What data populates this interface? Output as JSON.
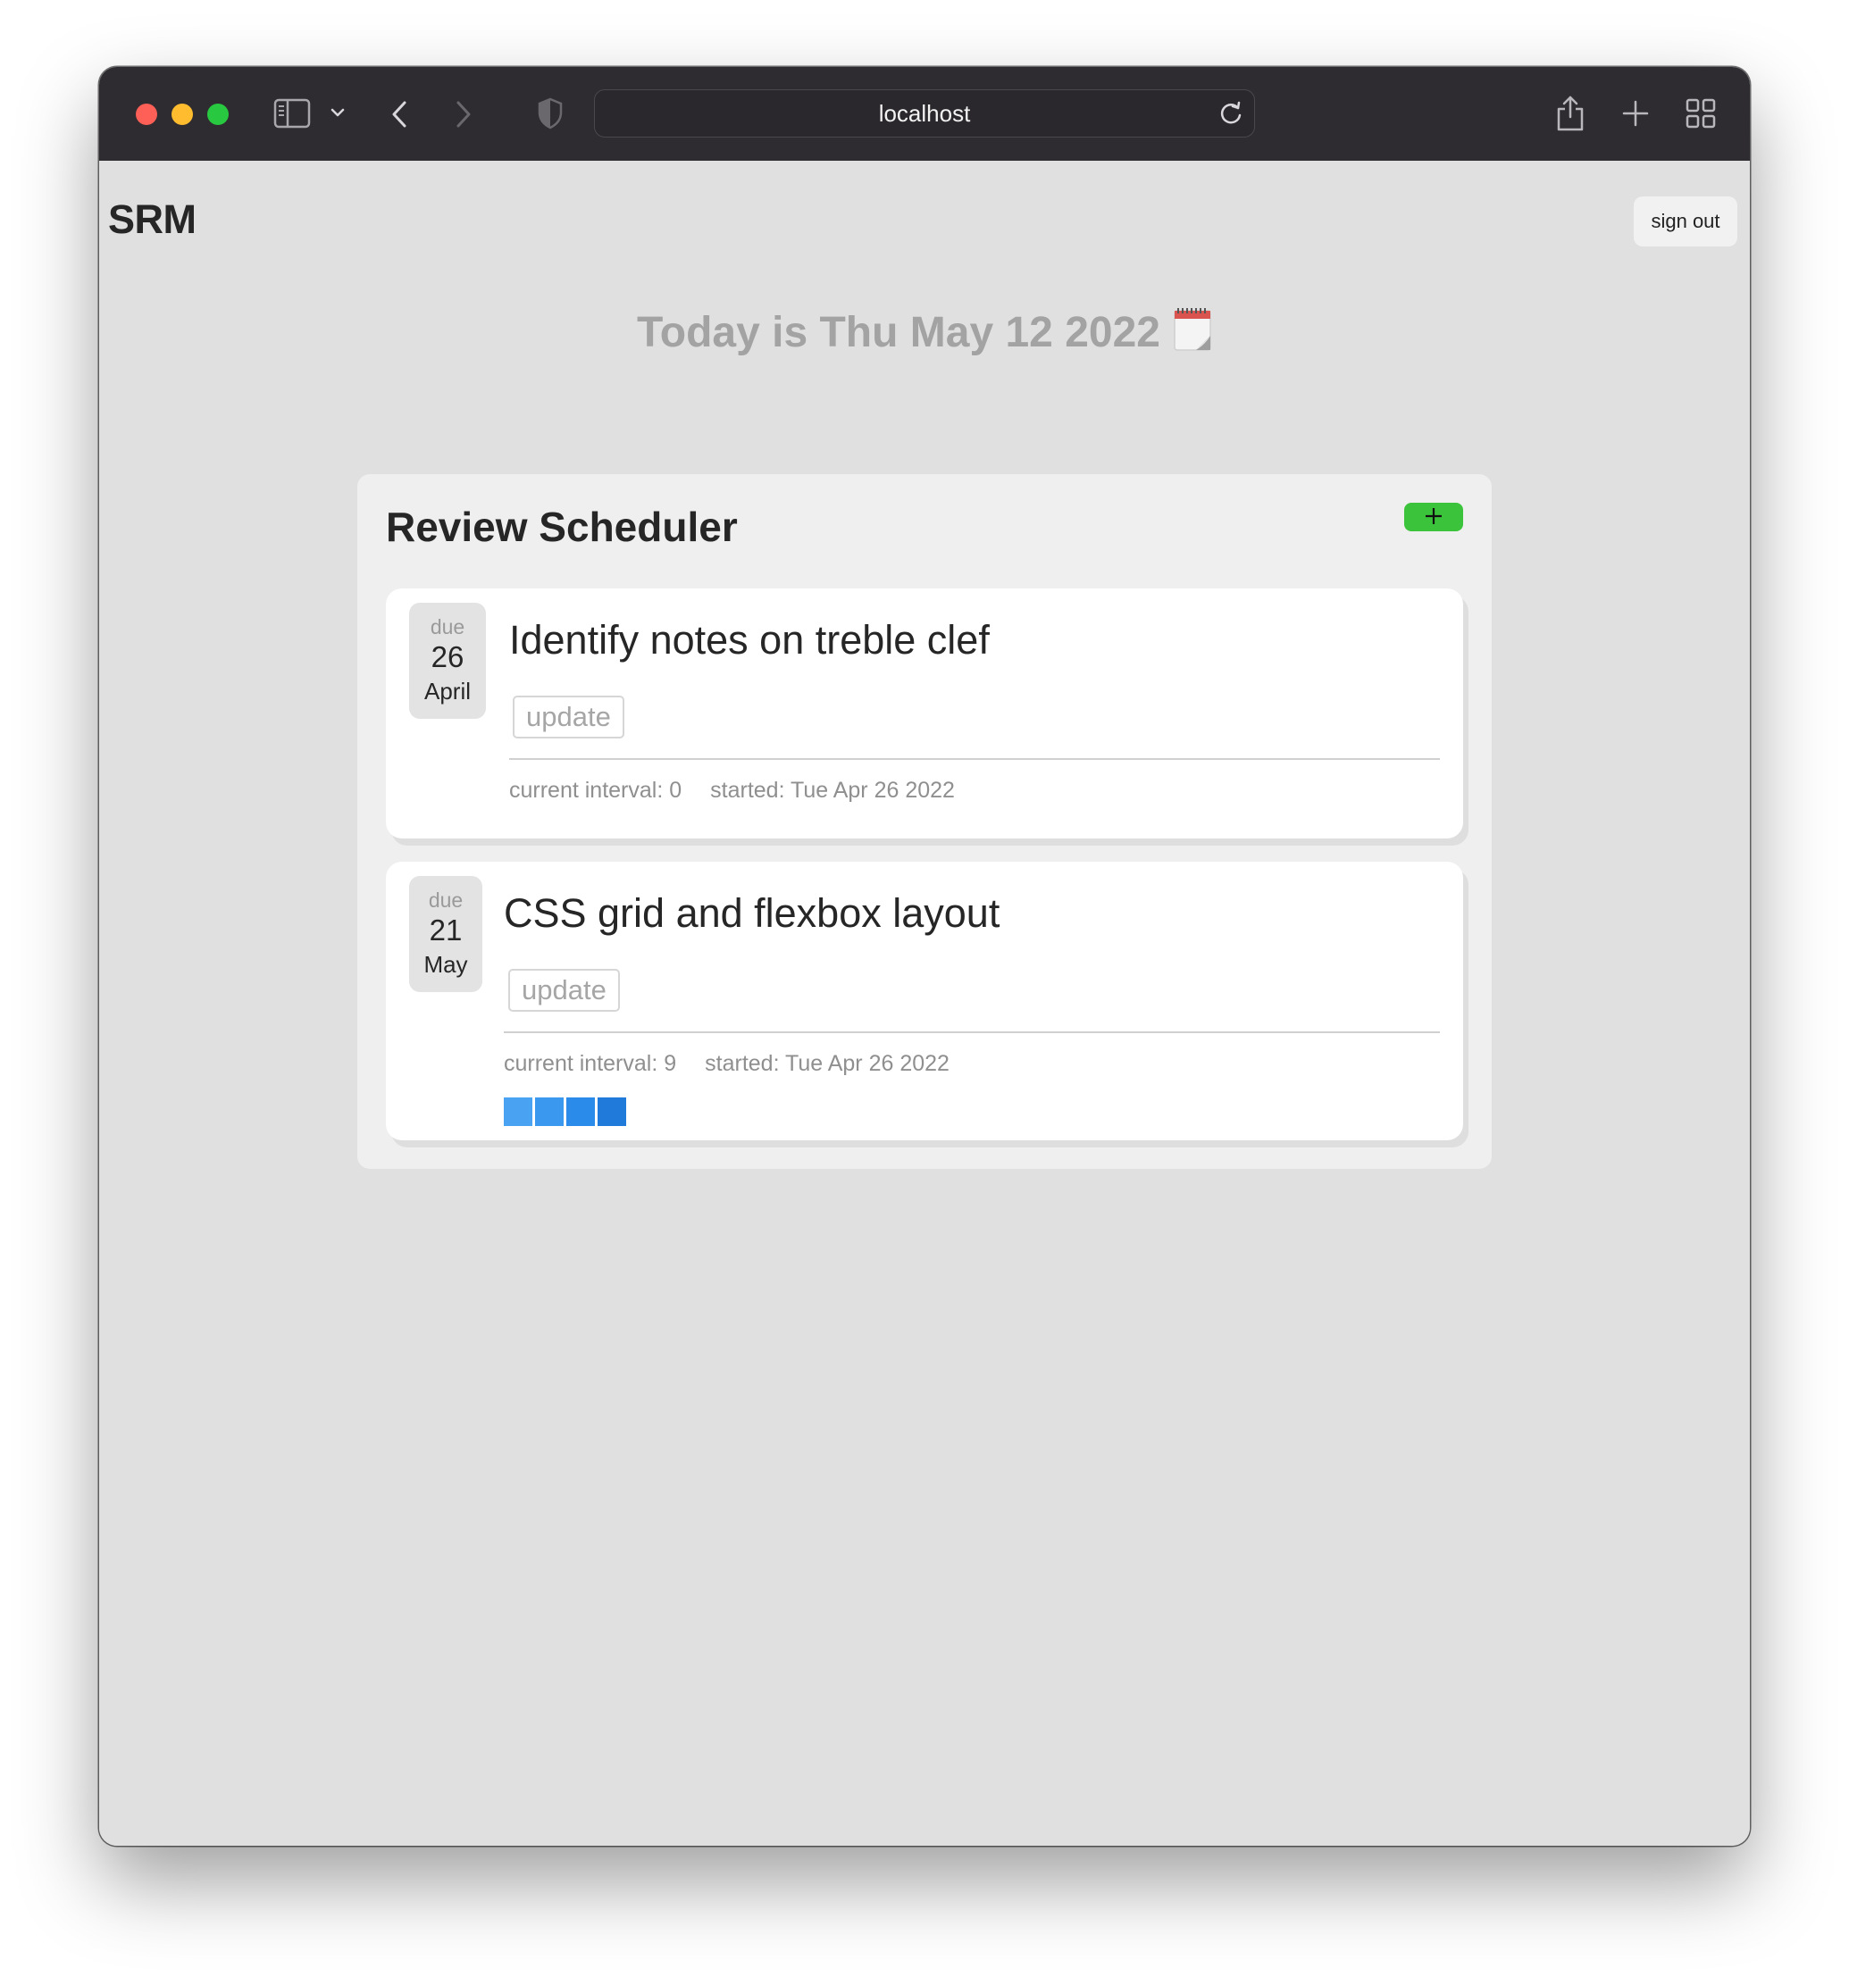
{
  "browser": {
    "url": "localhost"
  },
  "header": {
    "brand": "SRM",
    "sign_out_label": "sign out"
  },
  "today_text": "Today is Thu May 12 2022",
  "scheduler": {
    "title": "Review Scheduler",
    "add_button_icon": "plus-icon",
    "add_button_color": "#3bc43b",
    "items": [
      {
        "due_word": "due",
        "due_day": "26",
        "due_month": "April",
        "title": "Identify notes on treble clef",
        "update_label": "update",
        "current_interval": "current interval: 0",
        "started": "started: Tue Apr 26 2022",
        "progress_colors": []
      },
      {
        "due_word": "due",
        "due_day": "21",
        "due_month": "May",
        "title": "CSS grid and flexbox layout",
        "update_label": "update",
        "current_interval": "current interval: 9",
        "started": "started: Tue Apr 26 2022",
        "progress_colors": [
          "#4aa3f2",
          "#3a98ef",
          "#2b8bea",
          "#1f7ad9"
        ]
      }
    ]
  }
}
